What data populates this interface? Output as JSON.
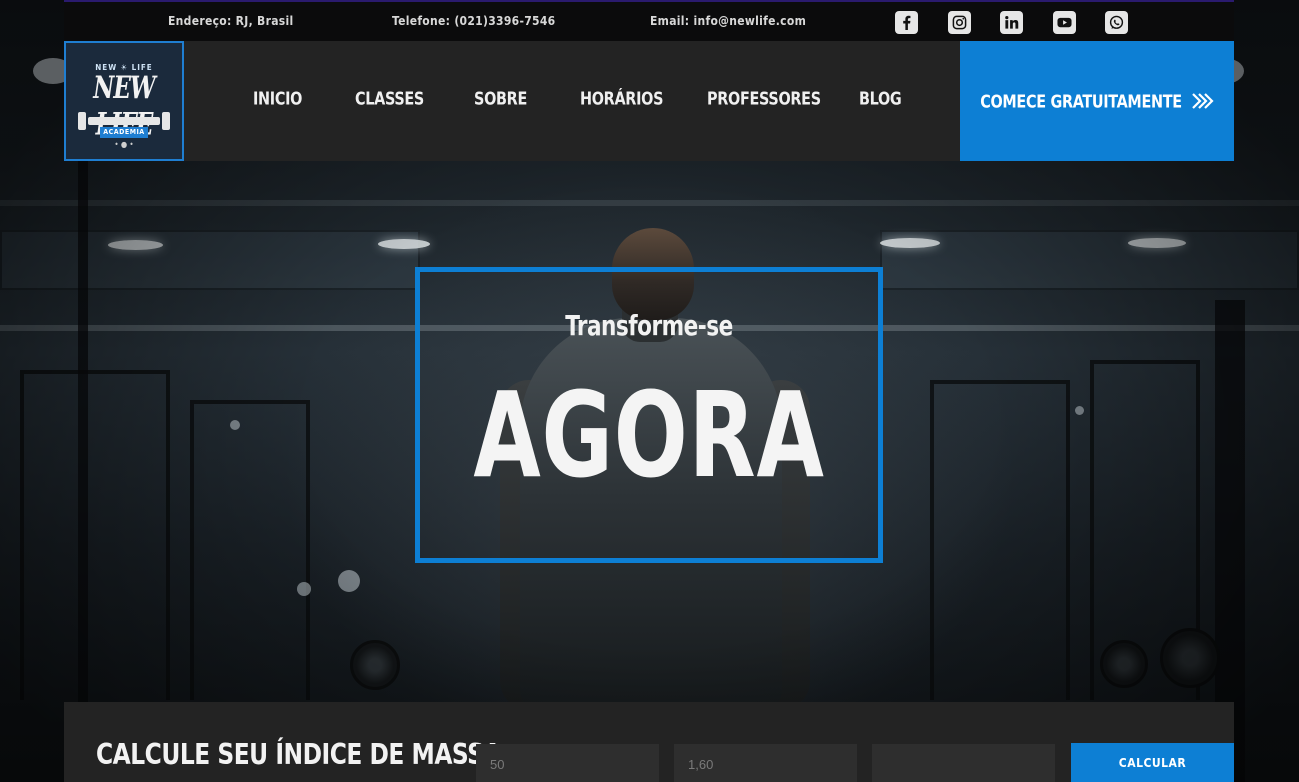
{
  "topbar": {
    "address": "Endereço: RJ, Brasil",
    "phone": "Telefone: (021)3396-7546",
    "email": "Email: info@newlife.com",
    "social_icons": [
      "facebook-icon",
      "instagram-icon",
      "linkedin-icon",
      "youtube-icon",
      "whatsapp-icon"
    ]
  },
  "logo": {
    "small_text": "NEW ☀ LIFE",
    "main_text": "NEW LIFE",
    "badge_text": "ACADEMIA"
  },
  "nav": {
    "items": [
      "INICIO",
      "CLASSES",
      "SOBRE",
      "HORÁRIOS",
      "PROFESSORES",
      "BLOG"
    ]
  },
  "cta": {
    "label": "COMECE GRATUITAMENTE",
    "icon": "double-chevron-right-icon"
  },
  "hero": {
    "subtitle": "Transforme-se",
    "title": "AGORA"
  },
  "bmi": {
    "heading": "CALCULE SEU ÍNDICE DE MASSA",
    "weight_placeholder": "50",
    "height_placeholder": "1,60",
    "third_placeholder": "",
    "button_label": "CALCULAR"
  },
  "colors": {
    "accent": "#0d7fd4",
    "nav_bg": "#232323",
    "topbar_bg": "#0b0b0c"
  }
}
